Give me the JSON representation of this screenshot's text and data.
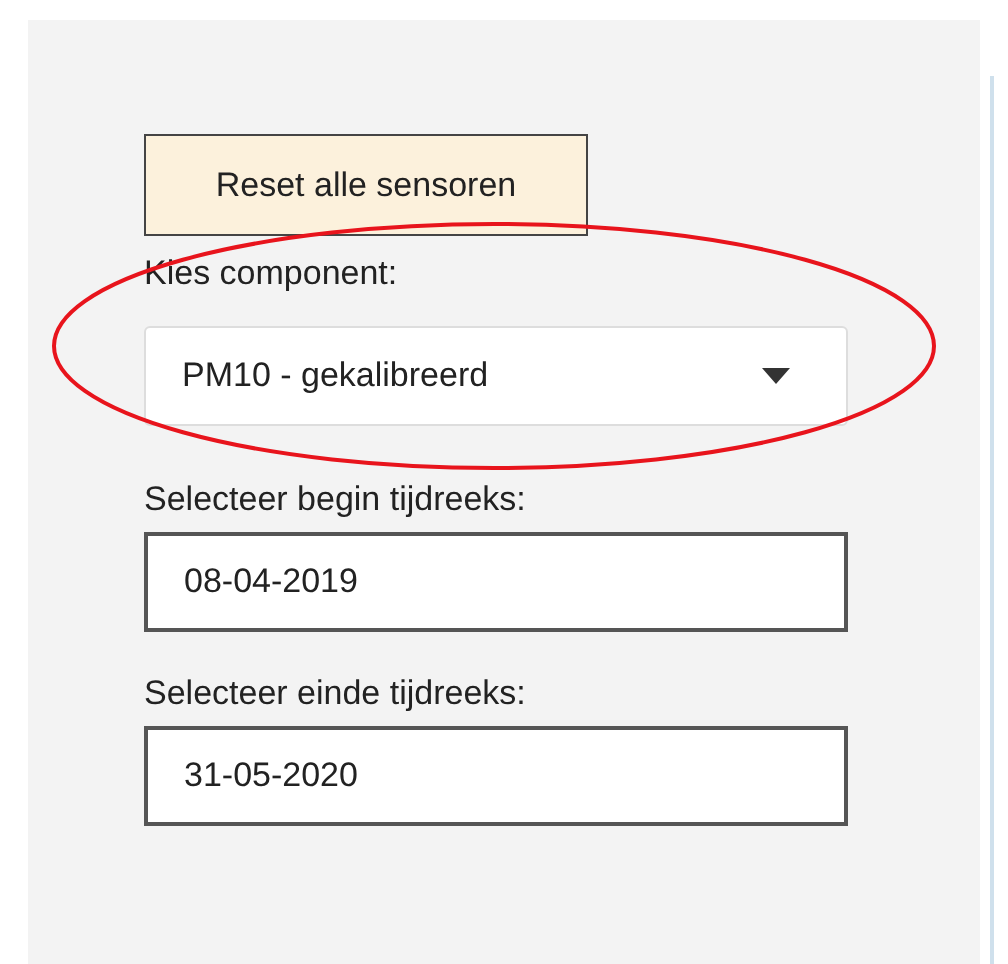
{
  "reset_button": {
    "label": "Reset alle sensoren"
  },
  "component": {
    "label": "Kies component:",
    "value": "PM10 - gekalibreerd"
  },
  "begin": {
    "label": "Selecteer begin tijdreeks:",
    "value": "08-04-2019"
  },
  "end": {
    "label": "Selecteer einde tijdreeks:",
    "value": "31-05-2020"
  }
}
